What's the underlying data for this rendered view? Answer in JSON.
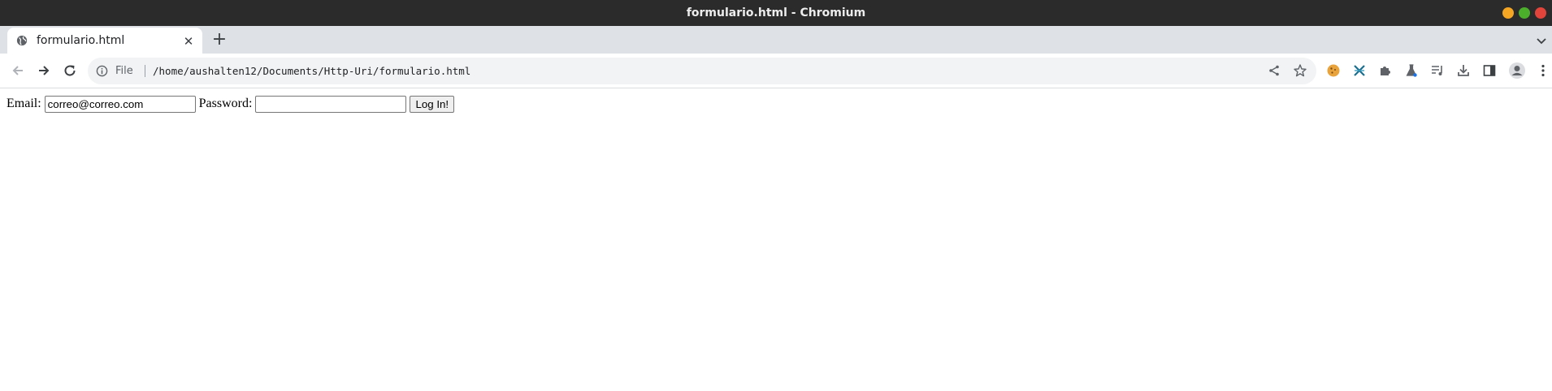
{
  "window": {
    "title": "formulario.html - Chromium"
  },
  "tabs": [
    {
      "label": "formulario.html",
      "icon": "globe-icon"
    }
  ],
  "address_bar": {
    "scheme_label": "File",
    "url": "/home/aushalten12/Documents/Http-Uri/formulario.html"
  },
  "extensions": [
    "cookie-icon",
    "extension-x-icon",
    "puzzle-icon",
    "flask-icon",
    "reading-list-icon",
    "download-icon",
    "side-panel-icon",
    "profile-icon",
    "menu-icon"
  ],
  "form": {
    "email_label": "Email:",
    "email_value": "correo@correo.com",
    "password_label": "Password:",
    "password_value": "",
    "submit_label": "Log In!"
  },
  "colors": {
    "titlebar": "#2b2b2b",
    "tabstrip": "#dee1e6",
    "omnibox": "#f1f3f4",
    "minimize": "#f5a623",
    "maximize": "#4caf2c",
    "close": "#e0443b"
  }
}
